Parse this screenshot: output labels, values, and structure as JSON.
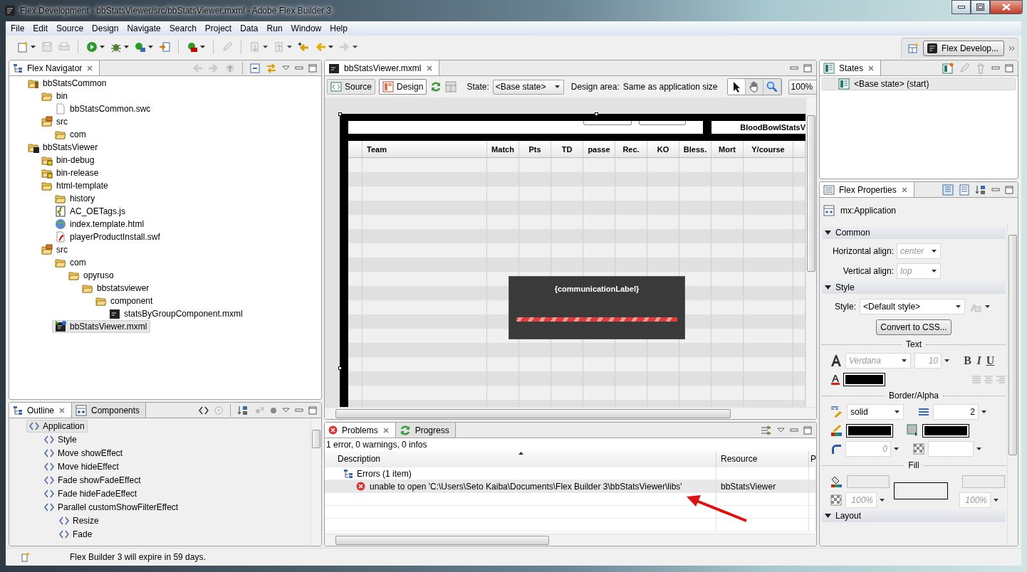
{
  "window": {
    "title": "Flex Development - bbStatsViewer/src/bbStatsViewer.mxml - Adobe Flex Builder 3"
  },
  "menu": [
    "File",
    "Edit",
    "Source",
    "Design",
    "Navigate",
    "Search",
    "Project",
    "Data",
    "Run",
    "Window",
    "Help"
  ],
  "toolbar": {
    "perspective": "Flex Develop..."
  },
  "navigator": {
    "tab": {
      "label": "Flex Navigator",
      "selected": true
    },
    "tree": [
      {
        "label": "bbStatsCommon",
        "kind": "library-project",
        "selected": false,
        "children": [
          {
            "label": "bin",
            "kind": "folder",
            "selected": false,
            "children": [
              {
                "label": "bbStatsCommon.swc",
                "kind": "file",
                "selected": false
              }
            ]
          },
          {
            "label": "src",
            "kind": "source-folder",
            "selected": false,
            "children": [
              {
                "label": "com",
                "kind": "folder",
                "selected": false
              }
            ]
          }
        ]
      },
      {
        "label": "bbStatsViewer",
        "kind": "flex-project",
        "selected": false,
        "children": [
          {
            "label": "bin-debug",
            "kind": "output-folder",
            "selected": false
          },
          {
            "label": "bin-release",
            "kind": "output-folder",
            "selected": false
          },
          {
            "label": "html-template",
            "kind": "folder",
            "selected": false,
            "children": [
              {
                "label": "history",
                "kind": "folder",
                "selected": false
              },
              {
                "label": "AC_OETags.js",
                "kind": "script",
                "selected": false
              },
              {
                "label": "index.template.html",
                "kind": "web",
                "selected": false
              },
              {
                "label": "playerProductInstall.swf",
                "kind": "swf",
                "selected": false
              }
            ]
          },
          {
            "label": "src",
            "kind": "source-folder",
            "selected": false,
            "children": [
              {
                "label": "com",
                "kind": "folder",
                "selected": false,
                "children": [
                  {
                    "label": "opyruso",
                    "kind": "folder",
                    "selected": false,
                    "children": [
                      {
                        "label": "bbstatsviewer",
                        "kind": "folder",
                        "selected": false,
                        "children": [
                          {
                            "label": "component",
                            "kind": "folder",
                            "selected": false,
                            "children": [
                              {
                                "label": "statsByGroupComponent.mxml",
                                "kind": "mxml",
                                "selected": false
                              }
                            ]
                          }
                        ]
                      }
                    ]
                  }
                ]
              },
              {
                "label": "bbStatsViewer.mxml",
                "kind": "app-mxml",
                "selected": true
              }
            ]
          }
        ]
      }
    ]
  },
  "editor": {
    "tab": {
      "label": "bbStatsViewer.mxml",
      "selected": true
    },
    "modes": [
      {
        "label": "Source",
        "kind": "source",
        "selected": false
      },
      {
        "label": "Design",
        "kind": "design",
        "selected": true
      }
    ],
    "state_label": "State:",
    "state": "<Base state>",
    "design_area_label": "Design area:",
    "design_area": "Same as application size",
    "tools": [
      {
        "kind": "select",
        "selected": true
      },
      {
        "kind": "pan",
        "selected": false
      },
      {
        "kind": "zoom",
        "selected": false
      }
    ],
    "zoom": "100%",
    "canvas": {
      "app_title": "BloodBowlStatsV",
      "columns": [
        "Team",
        "Match",
        "Pts",
        "TD",
        "passe",
        "Rec.",
        "KO",
        "Bless.",
        "Mort",
        "Y/course"
      ],
      "overlay_label": "{communicationLabel}"
    }
  },
  "states": {
    "tab": {
      "label": "States",
      "selected": true
    },
    "items": [
      {
        "label": "<Base state> (start)",
        "selected": true
      }
    ]
  },
  "properties": {
    "tab": {
      "label": "Flex Properties",
      "selected": true
    },
    "component": "mx:Application",
    "sections": [
      {
        "kind": "common",
        "title": "Common",
        "expanded": true,
        "rows": [
          {
            "label": "Horizontal align:",
            "placeholder": "center"
          },
          {
            "label": "Vertical align:",
            "placeholder": "top"
          }
        ]
      },
      {
        "kind": "style",
        "title": "Style",
        "expanded": true,
        "label": "Style:",
        "value": "<Default style>",
        "button": "Convert to CSS...",
        "text_heading": "Text",
        "font": {
          "placeholder": "Verdana"
        },
        "size": {
          "placeholder": "10"
        },
        "format_buttons": [
          {
            "label": "B",
            "kind": "bold"
          },
          {
            "label": "I",
            "kind": "italic"
          },
          {
            "label": "U",
            "kind": "underline"
          }
        ],
        "border_heading": "Border/Alpha",
        "border_style": "solid",
        "border_thickness": "2",
        "corner_radius": {
          "placeholder": "0"
        },
        "fill_heading": "Fill",
        "fill_alpha": [
          {
            "placeholder": "100%"
          },
          {
            "placeholder": "100%"
          }
        ]
      },
      {
        "kind": "layout",
        "title": "Layout",
        "expanded": true
      }
    ]
  },
  "outline": {
    "tabs": [
      {
        "label": "Outline",
        "kind": "outline",
        "selected": true
      },
      {
        "label": "Components",
        "kind": "components",
        "selected": false
      }
    ],
    "tree": [
      {
        "label": "Application",
        "selected": true,
        "children": [
          {
            "label": "Style",
            "selected": false
          },
          {
            "label": "Move showEffect",
            "selected": false
          },
          {
            "label": "Move hideEffect",
            "selected": false
          },
          {
            "label": "Fade showFadeEffect",
            "selected": false
          },
          {
            "label": "Fade hideFadeEffect",
            "selected": false
          },
          {
            "label": "Parallel customShowFilterEffect",
            "selected": false,
            "children": [
              {
                "label": "Resize",
                "selected": false
              },
              {
                "label": "Fade",
                "selected": false
              }
            ]
          }
        ]
      }
    ]
  },
  "problems": {
    "tabs": [
      {
        "label": "Problems",
        "kind": "problems",
        "selected": true
      },
      {
        "label": "Progress",
        "kind": "progress",
        "selected": false
      }
    ],
    "summary": "1 error, 0 warnings, 0 infos",
    "columns": [
      "Description",
      "Resource",
      "P"
    ],
    "groups": [
      {
        "label": "Errors (1 item)",
        "items": [
          {
            "description": "unable to open 'C:\\Users\\Seto Kaiba\\Documents\\Flex Builder 3\\bbStatsViewer\\libs'",
            "resource": "bbStatsViewer",
            "selected": true
          }
        ]
      }
    ]
  },
  "status_bar": {
    "message": "Flex Builder 3 will expire in 59 days."
  }
}
